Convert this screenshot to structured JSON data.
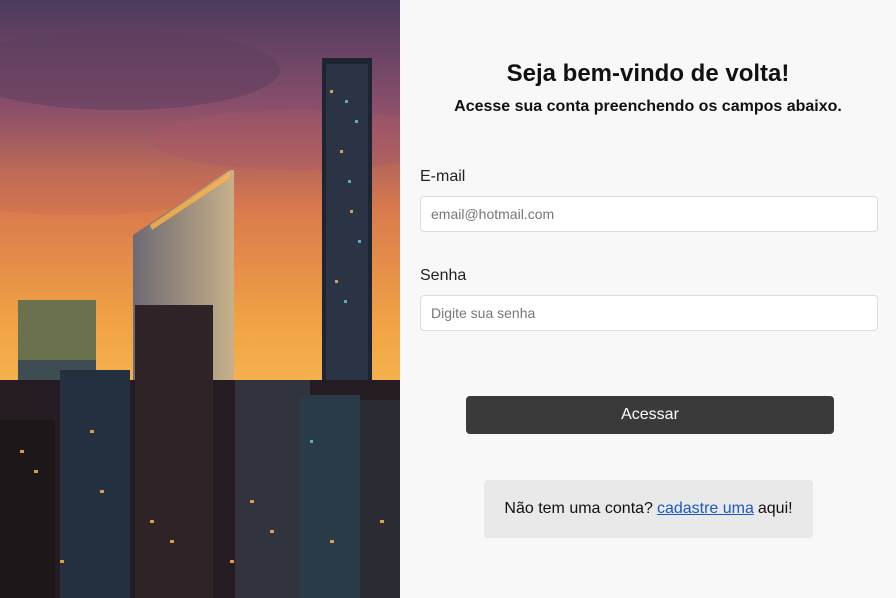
{
  "hero": {
    "image": "city-skyline-sunset"
  },
  "form": {
    "title": "Seja bem-vindo de volta!",
    "subtitle": "Acesse sua conta preenchendo os campos abaixo.",
    "email": {
      "label": "E-mail",
      "placeholder": "email@hotmail.com",
      "value": ""
    },
    "password": {
      "label": "Senha",
      "placeholder": "Digite sua senha",
      "value": ""
    },
    "submit_label": "Acessar"
  },
  "signup": {
    "prefix": "Não tem uma conta?",
    "link_text": "cadastre uma",
    "suffix": "aqui!"
  },
  "colors": {
    "button": "#3a3a3a",
    "link": "#1a57c8",
    "panel_bg": "#f8f8f8",
    "signup_bg": "#e9e9e9"
  }
}
